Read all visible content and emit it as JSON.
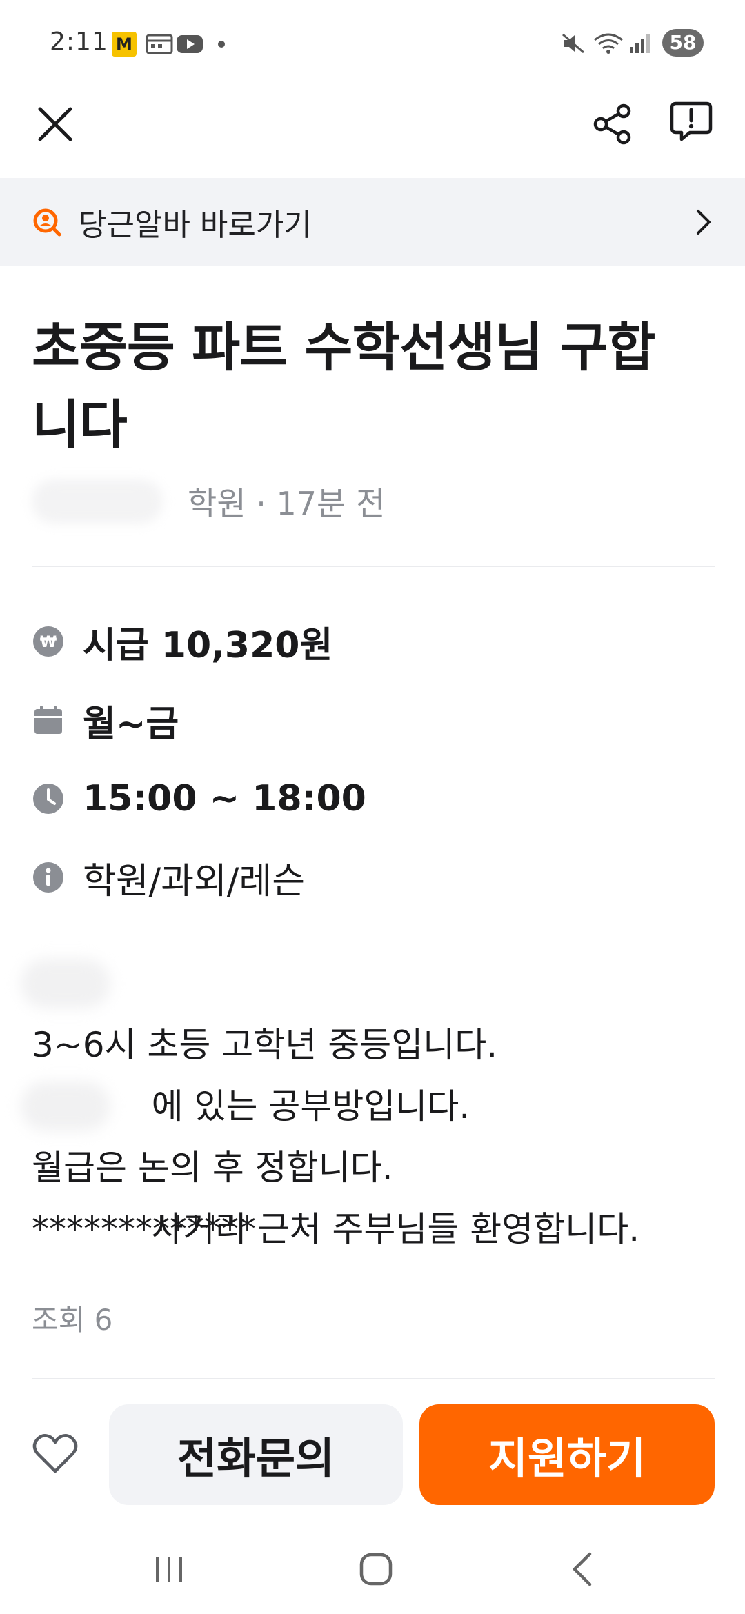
{
  "status_bar": {
    "time": "2:11",
    "kakao_badge": "M",
    "battery": "58"
  },
  "banner": {
    "label": "당근알바 바로가기"
  },
  "post": {
    "title_line1": "초중등 파트 수학선생님 구합",
    "title_line2": "니다",
    "meta": "학원 · 17분 전"
  },
  "info": {
    "wage": "시급 10,320원",
    "days": "월~금",
    "hours": "15:00 ~ 18:00",
    "category": "학원/과외/레슨"
  },
  "description": {
    "line1": "에 있는 공부방입니다.",
    "line2": "3~6시 초등 고학년 중등입니다.",
    "line3": "사거리 근처 주부님들 환영합니다.",
    "line4": "월급은 논의 후 정합니다.",
    "line5": "*************"
  },
  "views": "조회 6",
  "actions": {
    "call": "전화문의",
    "apply": "지원하기"
  },
  "colors": {
    "accent": "#ff6600",
    "banner_bg": "#f2f3f6",
    "muted_text": "#8b8e94",
    "icon_gray": "#8b8e94"
  }
}
